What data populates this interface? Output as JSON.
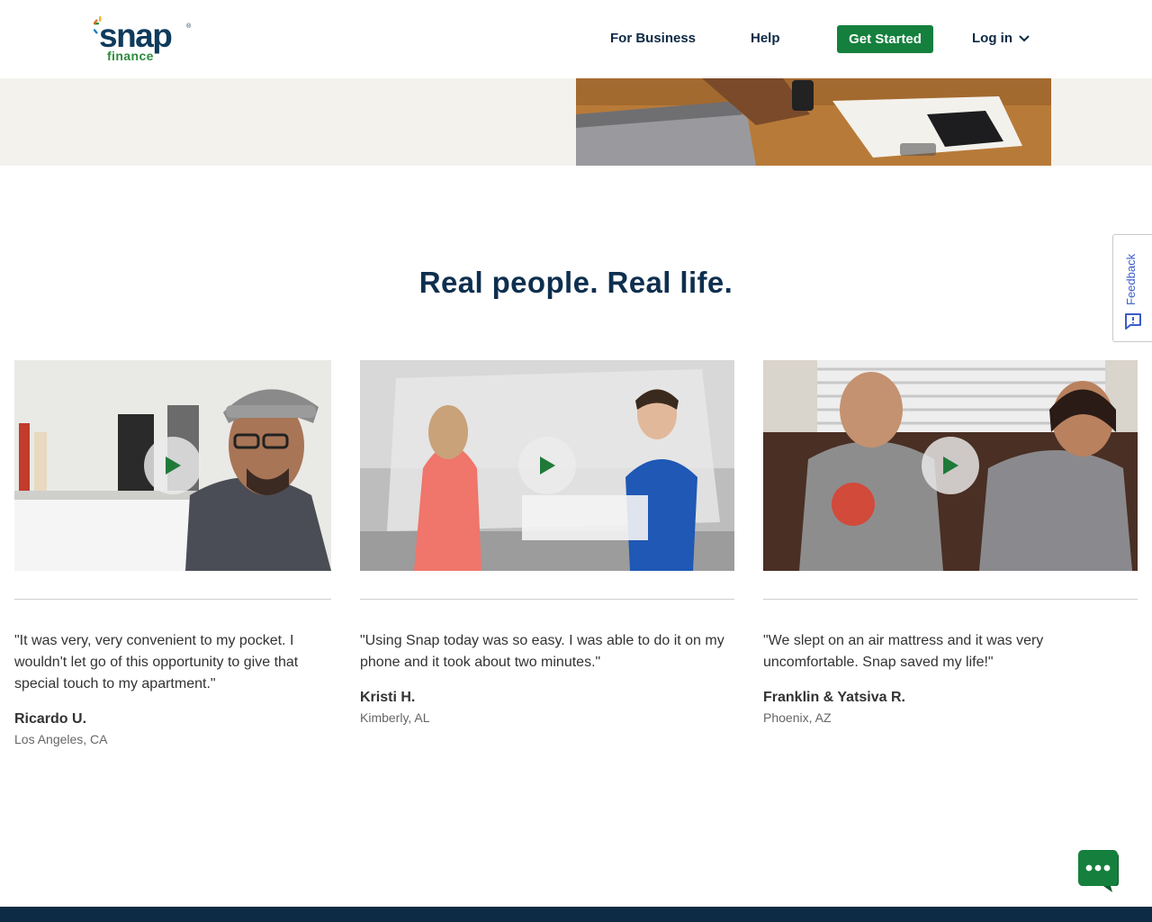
{
  "brand": {
    "logo_main": "snap",
    "logo_sub": "finance",
    "registered": "®",
    "colors": {
      "navy": "#0e3a5c",
      "green": "#2e8b3e",
      "button_green": "#15803d",
      "footer": "#0d2b45"
    }
  },
  "nav": {
    "for_business": "For Business",
    "help": "Help",
    "get_started": "Get Started",
    "login": "Log in"
  },
  "section": {
    "title": "Real people. Real life."
  },
  "testimonials": [
    {
      "quote": "\"It was very, very convenient to my pocket. I wouldn't let go of this opportunity to give that special touch to my apartment.\"",
      "name": "Ricardo U.",
      "location": "Los Angeles, CA"
    },
    {
      "quote": "\"Using Snap today was so easy. I was able to do it on my phone and it took about two minutes.\"",
      "name": "Kristi H.",
      "location": "Kimberly, AL"
    },
    {
      "quote": "\"We slept on an air mattress and it was very uncomfortable. Snap saved my life!\"",
      "name": "Franklin & Yatsiva R.",
      "location": "Phoenix, AZ"
    }
  ],
  "feedback": {
    "label": "Feedback"
  },
  "icons": {
    "play": "play-icon",
    "chevron": "chevron-down-icon",
    "feedback": "feedback-icon",
    "chat": "chat-icon"
  }
}
